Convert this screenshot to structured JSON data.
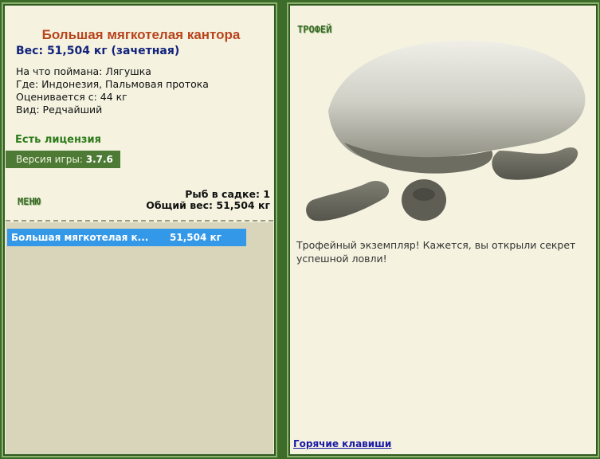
{
  "fish": {
    "title": "Большая мягкотелая кантора",
    "weight": "Вес: 51,504 кг (зачетная)",
    "caught_on": "На что поймана: Лягушка",
    "location": "Где: Индонезия, Пальмовая протока",
    "valued_from": "Оценивается с: 44 кг",
    "kind": "Вид: Редчайший"
  },
  "license": "Есть лицензия",
  "version": {
    "label": "Версия игры:",
    "value": "3.7.6"
  },
  "menu_label": "МЕНЮ",
  "keepnet": {
    "count_text": "Рыб в садке: 1",
    "total_text": "Общий вес: 51,504 кг",
    "rows": [
      {
        "name": "Большая мягкотелая к...",
        "weight": "51,504 кг"
      }
    ]
  },
  "trophy": {
    "label": "ТРОФЕЙ",
    "text": "Трофейный экземпляр! Кажется, вы открыли секрет успешной ловли!"
  },
  "hotkeys_link": "Горячие клавиши",
  "colors": {
    "title": "#b8441c",
    "weight": "#13237c",
    "license": "#2d7a1b",
    "accent_green": "#4d7a34",
    "selection": "#3398e8",
    "link": "#1a1aa8"
  }
}
